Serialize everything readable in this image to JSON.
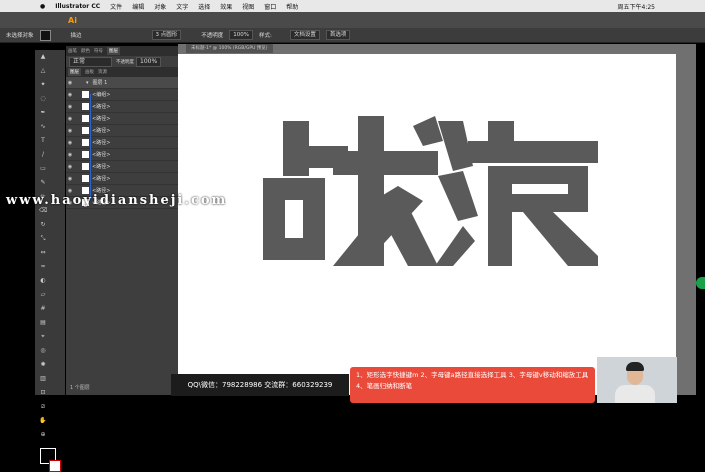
{
  "menubar": {
    "app_name": "Illustrator CC",
    "items": [
      "文件",
      "编辑",
      "对象",
      "文字",
      "选择",
      "效果",
      "视图",
      "窗口",
      "帮助"
    ],
    "clock": "周五下午4:25"
  },
  "control_bar": {
    "selection_label": "未选择对象",
    "stroke_label": "描边",
    "stroke_profile": "3 点圆形",
    "opacity_label": "不透明度",
    "opacity_value": "100%",
    "style_label": "样式:",
    "doc_setup": "文档设置",
    "preferences": "首选项"
  },
  "layers_panel": {
    "tabs": [
      "画笔",
      "颜色",
      "符号",
      "图层"
    ],
    "active_tab": "图层",
    "blend_mode": "正常",
    "opacity_label": "不透明度",
    "opacity_value": "100%",
    "subtabs": [
      "图层",
      "画板",
      "资源"
    ],
    "layer_name": "图层 1",
    "rows": [
      "<编组>",
      "<路径>",
      "<路径>",
      "<路径>",
      "<路径>",
      "<路径>",
      "<路径>",
      "<路径>",
      "<路径>",
      "<路径>"
    ],
    "footer": "1 个图层"
  },
  "document": {
    "tab_title": "未标题-1* @ 100% (RGB/GPU 预览)",
    "artwork_text": "战狼",
    "artwork_color": "#5a5a5a"
  },
  "overlays": {
    "watermark": "www.haoyidiansheji.com",
    "qq_info": "QQ\\微信：798228986  交流群：660329239",
    "hint_text": "1、矩形选字快捷键m  2、字母键a路径直接选择工具  3、字母键v移动和缩放工具  4、笔画归纳和断笔"
  }
}
